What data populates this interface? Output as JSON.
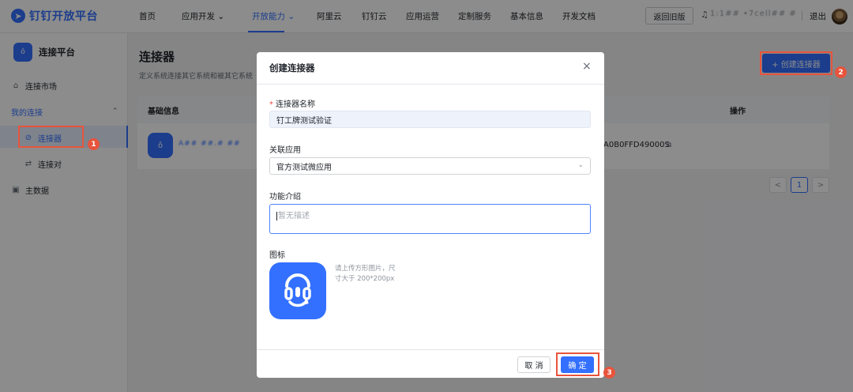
{
  "colors": {
    "accent": "#3370ff",
    "annotation_red": "#e8543c"
  },
  "topnav": {
    "logo_icon": "dingtalk-logo-icon",
    "logo_text": "钉钉开放平台",
    "items": [
      "首页",
      "应用开发",
      "开放能力",
      "阿里云",
      "钉钉云",
      "应用运营",
      "定制服务",
      "基本信息",
      "开发文档"
    ],
    "active_item": "开放能力",
    "old_version": "返回旧版",
    "bell_icon": "bell-icon",
    "user_name": "1:1## •7cell## #",
    "logout": "退出",
    "chevron": "⌄"
  },
  "sidebar": {
    "app_title": "连接平台",
    "items": {
      "market": "连接市场",
      "my_connections": "我的连接",
      "connector": "连接器",
      "connector_pair": "连接对",
      "master_data": "主数据"
    },
    "collapse_icon": "chevron-up-icon"
  },
  "main": {
    "title": "连接器",
    "description": "定义系统连接其它系统和被其它系统",
    "create_button": "+ 创建连接器",
    "table": {
      "headers": {
        "basic_info": "基础信息",
        "actions": "操作"
      },
      "row": {
        "name": "A## ##.# ##",
        "id": "A0B0FFD49000S"
      }
    },
    "pagination": {
      "prev": "<",
      "current": "1",
      "next": ">"
    }
  },
  "modal": {
    "title": "创建连接器",
    "close": "×",
    "fields": {
      "name_label": "连接器名称",
      "name_value": "钉工牌测试验证",
      "app_label": "关联应用",
      "app_value": "官方测试微应用",
      "intro_label": "功能介绍",
      "intro_placeholder": "暂无描述",
      "icon_label": "图标",
      "icon_hint_1": "请上传方形图片，尺",
      "icon_hint_2": "寸大于 200*200px"
    },
    "cancel": "取 消",
    "confirm": "确 定"
  },
  "annotations": {
    "step1": "1",
    "step2": "2",
    "step3": "3"
  }
}
